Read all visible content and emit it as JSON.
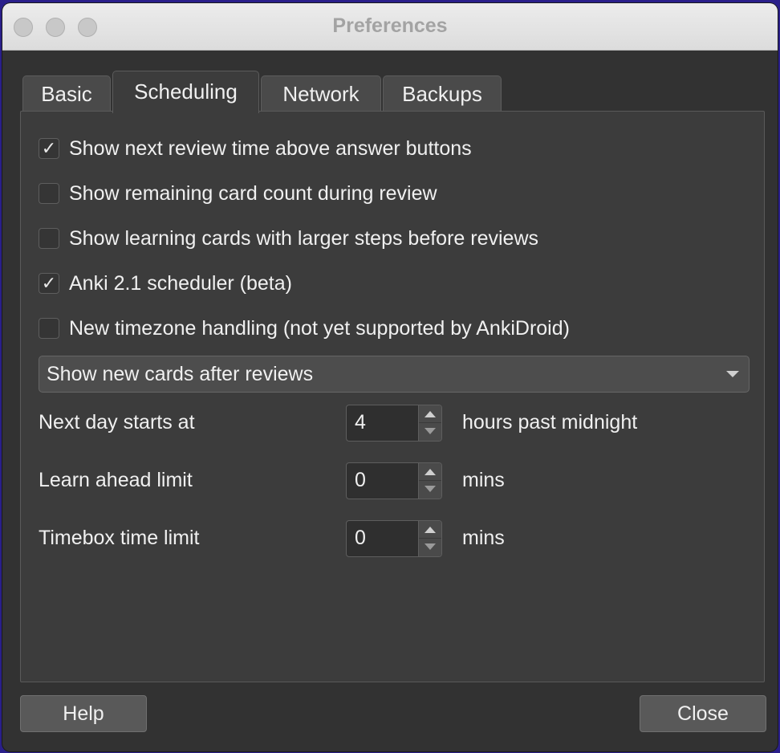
{
  "window": {
    "title": "Preferences"
  },
  "tabs": [
    {
      "label": "Basic",
      "active": false
    },
    {
      "label": "Scheduling",
      "active": true
    },
    {
      "label": "Network",
      "active": false
    },
    {
      "label": "Backups",
      "active": false
    }
  ],
  "scheduling": {
    "checkboxes": [
      {
        "label": "Show next review time above answer buttons",
        "checked": true
      },
      {
        "label": "Show remaining card count during review",
        "checked": false
      },
      {
        "label": "Show learning cards with larger steps before reviews",
        "checked": false
      },
      {
        "label": "Anki 2.1 scheduler (beta)",
        "checked": true
      },
      {
        "label": "New timezone handling (not yet supported by AnkiDroid)",
        "checked": false
      }
    ],
    "new_cards_order": {
      "selected": "Show new cards after reviews"
    },
    "fields": [
      {
        "label": "Next day starts at",
        "value": "4",
        "unit": "hours past midnight"
      },
      {
        "label": "Learn ahead limit",
        "value": "0",
        "unit": "mins"
      },
      {
        "label": "Timebox time limit",
        "value": "0",
        "unit": "mins"
      }
    ]
  },
  "buttons": {
    "help_label": "Help",
    "close_label": "Close"
  },
  "icons": {
    "checkmark_glyph": "✓"
  }
}
